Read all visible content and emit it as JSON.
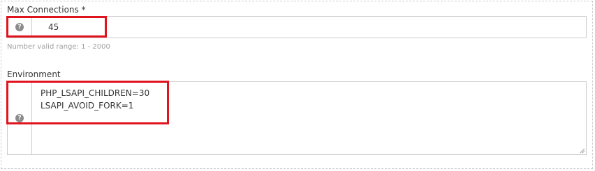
{
  "max_connections": {
    "label": "Max Connections *",
    "value": "45",
    "help_icon": "question-circle-icon",
    "help_text": "Number valid range: 1 - 2000"
  },
  "environment": {
    "label": "Environment",
    "value": "PHP_LSAPI_CHILDREN=30\nLSAPI_AVOID_FORK=1",
    "help_icon": "question-circle-icon"
  },
  "colors": {
    "highlight": "#e0141e",
    "border": "#cccccc",
    "help_text": "#a0a0a0"
  }
}
